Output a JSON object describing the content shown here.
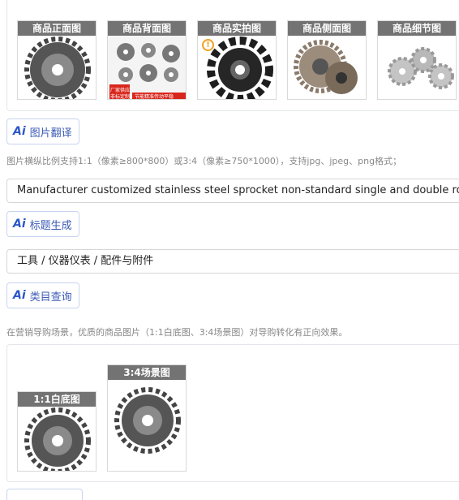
{
  "main_images": [
    {
      "label": "商品正面图"
    },
    {
      "label": "商品背面图"
    },
    {
      "label": "商品实拍图"
    },
    {
      "label": "商品侧面图"
    },
    {
      "label": "商品细节图"
    }
  ],
  "back_image_tags": [
    "厂家供应",
    "非标定制",
    "节能精准传动平稳"
  ],
  "image_translate_button": "图片翻译",
  "image_hint": "图片横纵比例支持1:1（像素≥800*800）或3:4（像素≥750*1000），支持jpg、jpeg、png格式；",
  "title_value": "Manufacturer customized stainless steel sprocket non-standard single and double row co",
  "title_generate_button": "标题生成",
  "category_value": "工具 / 仪器仪表 / 配件与附件",
  "category_query_button": "类目查询",
  "guide_hint": "在营销导购场景，优质的商品图片（1:1白底图、3:4场景图）对导购转化有正向效果。",
  "guide_images": [
    {
      "label": "1:1白底图"
    },
    {
      "label": "3:4场景图"
    }
  ],
  "colors": {
    "accent": "#2c57c9",
    "warning": "#f0a020"
  }
}
